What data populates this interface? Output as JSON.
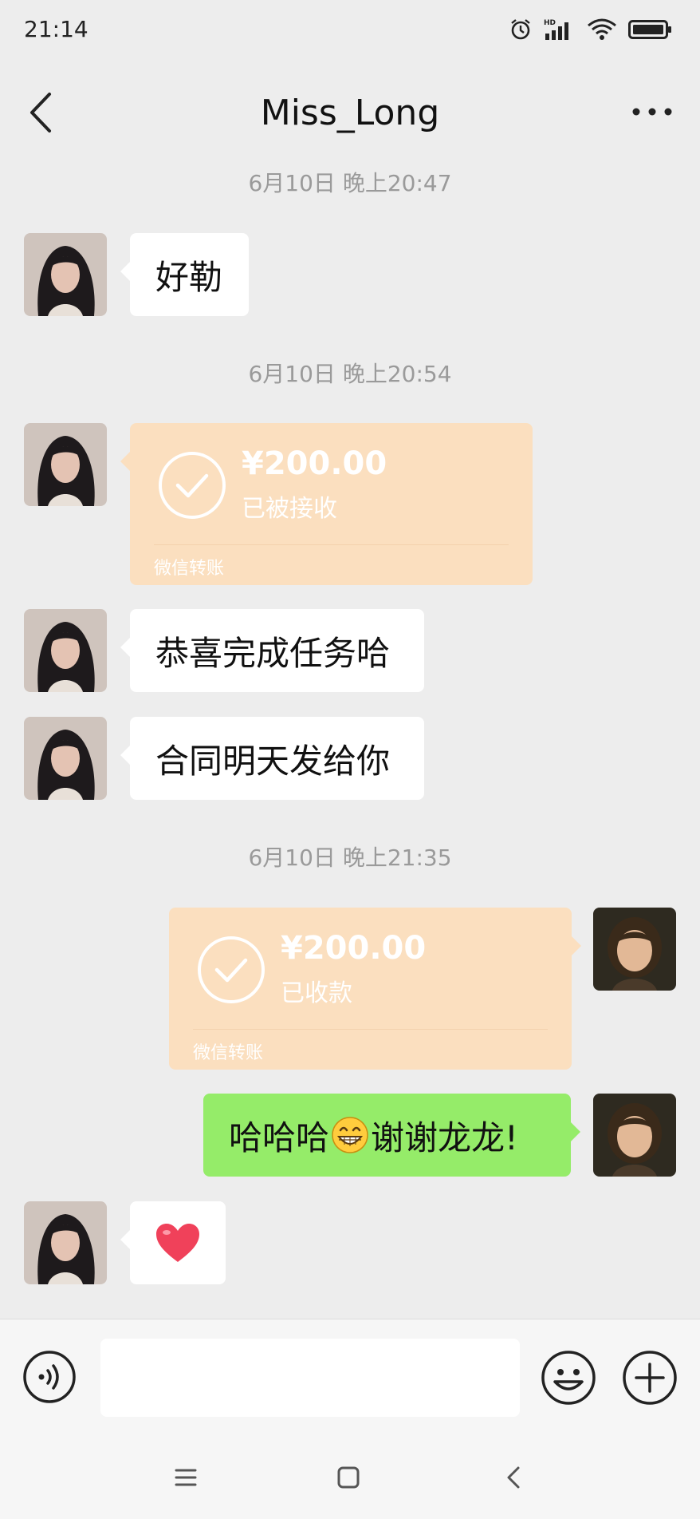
{
  "status_bar": {
    "time": "21:14",
    "icons": [
      "alarm-icon",
      "hd-signal-icon",
      "wifi-icon",
      "battery-icon"
    ]
  },
  "header": {
    "title": "Miss_Long",
    "back_icon": "back-chevron-icon",
    "more_icon": "more-dots-icon"
  },
  "messages": [
    {
      "type": "timestamp",
      "text": "6月10日 晚上20:47"
    },
    {
      "type": "text",
      "side": "left",
      "text": "好勒"
    },
    {
      "type": "timestamp",
      "text": "6月10日 晚上20:54"
    },
    {
      "type": "transfer",
      "side": "left",
      "amount": "¥200.00",
      "status": "已被接收",
      "footer": "微信转账"
    },
    {
      "type": "text",
      "side": "left",
      "text": "恭喜完成任务哈"
    },
    {
      "type": "text",
      "side": "left",
      "text": "合同明天发给你"
    },
    {
      "type": "timestamp",
      "text": "6月10日 晚上21:35"
    },
    {
      "type": "transfer",
      "side": "right",
      "amount": "¥200.00",
      "status": "已收款",
      "footer": "微信转账"
    },
    {
      "type": "text",
      "side": "right",
      "text_before": "哈哈哈",
      "emoji": "grinning-emoji",
      "text_after": "谢谢龙龙!"
    },
    {
      "type": "sticker",
      "side": "left",
      "emoji": "heart-emoji"
    }
  ],
  "colors": {
    "background": "#ededed",
    "bubble_white": "#ffffff",
    "bubble_green": "#95ec69",
    "transfer_bg": "#fbdfbf",
    "heart": "#f0415a"
  },
  "input_bar": {
    "voice_icon": "voice-icon",
    "emoji_icon": "emoji-icon",
    "plus_icon": "plus-icon",
    "input_value": ""
  },
  "nav_bar": {
    "icons": [
      "menu-icon",
      "home-icon",
      "back-nav-icon"
    ]
  }
}
